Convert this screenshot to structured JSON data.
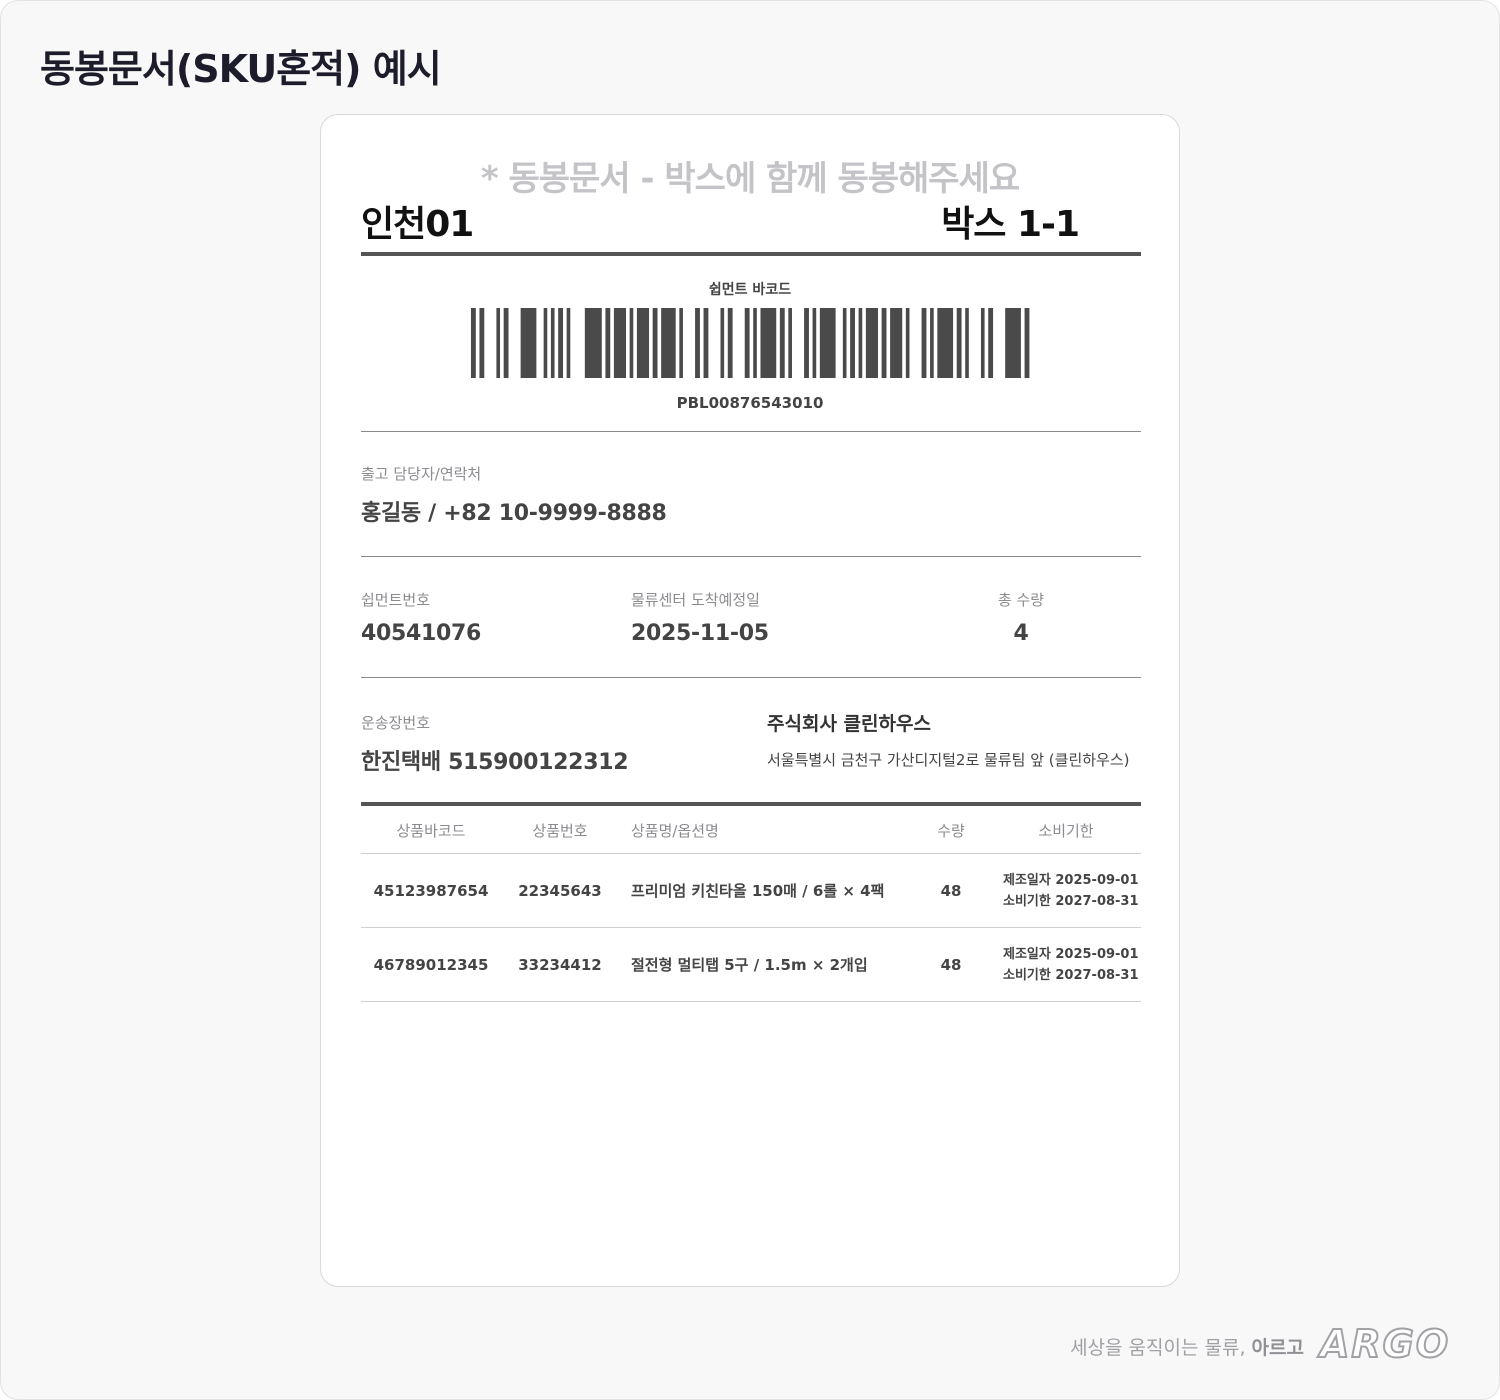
{
  "page": {
    "title": "동봉문서(SKU혼적) 예시"
  },
  "document": {
    "notice": "* 동봉문서 - 박스에 함께 동봉해주세요",
    "center_name": "인천01",
    "box_label": "박스 1-1",
    "barcode": {
      "label": "쉽먼트 바코드",
      "value": "PBL00876543010"
    },
    "manager": {
      "label": "출고 담당자/연락처",
      "value": "홍길동 / +82 10-9999-8888"
    },
    "shipment": {
      "label": "쉽먼트번호",
      "value": "40541076"
    },
    "arrival": {
      "label": "물류센터 도착예정일",
      "value": "2025-11-05"
    },
    "total_qty": {
      "label": "총 수량",
      "value": "4"
    },
    "waybill": {
      "label": "운송장번호",
      "value": "한진택배 515900122312"
    },
    "sender": {
      "company": "주식회사 클린하우스",
      "address": "서울특별시 금천구 가산디지털2로 물류팀 앞 (클린하우스)"
    },
    "table": {
      "headers": [
        "상품바코드",
        "상품번호",
        "상품명/옵션명",
        "수량",
        "소비기한"
      ],
      "rows": [
        {
          "barcode": "45123987654",
          "product_no": "22345643",
          "name": "프리미엄 키친타올 150매 / 6롤 × 4팩",
          "qty": "48",
          "mfg": "제조일자 2025-09-01",
          "exp": "소비기한 2027-08-31"
        },
        {
          "barcode": "46789012345",
          "product_no": "33234412",
          "name": "절전형 멀티탭 5구 / 1.5m × 2개입",
          "qty": "48",
          "mfg": "제조일자 2025-09-01",
          "exp": "소비기한 2027-08-31"
        }
      ]
    }
  },
  "footer": {
    "slogan_prefix": "세상을 움직이는 물류, ",
    "slogan_brand": "아르고",
    "logo": "ARGO"
  }
}
